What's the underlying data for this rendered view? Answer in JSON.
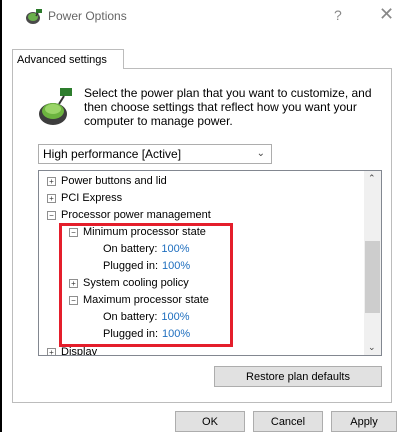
{
  "window": {
    "title": "Power Options",
    "help": "?",
    "close": "✕"
  },
  "tab": {
    "label": "Advanced settings"
  },
  "intro": {
    "text": "Select the power plan that you want to customize, and then choose settings that reflect how you want your computer to manage power."
  },
  "plan_select": {
    "value": "High performance [Active]"
  },
  "tree": {
    "items": [
      {
        "label": "Power buttons and lid",
        "state": "collapsed"
      },
      {
        "label": "PCI Express",
        "state": "collapsed"
      },
      {
        "label": "Processor power management",
        "state": "expanded"
      },
      {
        "label": "Minimum processor state",
        "state": "expanded"
      },
      {
        "label": "On battery:",
        "value": "100%"
      },
      {
        "label": "Plugged in:",
        "value": "100%"
      },
      {
        "label": "System cooling policy",
        "state": "collapsed"
      },
      {
        "label": "Maximum processor state",
        "state": "expanded"
      },
      {
        "label": "On battery:",
        "value": "100%"
      },
      {
        "label": "Plugged in:",
        "value": "100%"
      },
      {
        "label": "Display",
        "state": "collapsed"
      }
    ]
  },
  "buttons": {
    "restore": "Restore plan defaults",
    "ok": "OK",
    "cancel": "Cancel",
    "apply": "Apply"
  },
  "colors": {
    "highlight": "#e41e2b",
    "value_text": "#1f6fbf"
  }
}
